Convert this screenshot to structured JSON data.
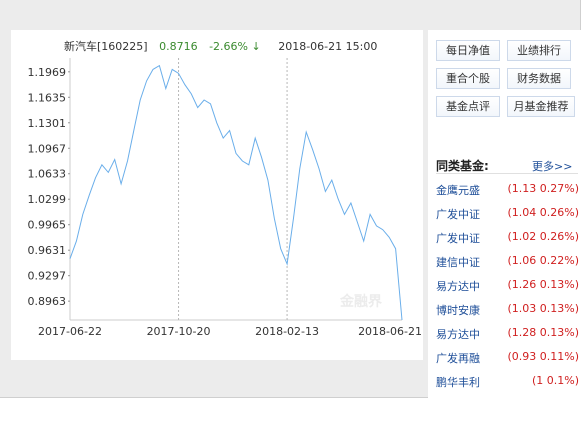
{
  "fund": {
    "name": "新汽车[160225]",
    "price": "0.8716",
    "change": "-2.66% ↓",
    "datetime": "2018-06-21 15:00"
  },
  "buttons": [
    {
      "label": "每日净值"
    },
    {
      "label": "业绩排行"
    },
    {
      "label": "重合个股"
    },
    {
      "label": "财务数据"
    },
    {
      "label": "基金点评"
    },
    {
      "label": "月基金推荐"
    }
  ],
  "peers": {
    "title": "同类基金:",
    "more": "更多>>",
    "items": [
      {
        "name": "金鹰元盛",
        "value": "(1.13 0.27%)"
      },
      {
        "name": "广发中证",
        "value": "(1.04 0.26%)"
      },
      {
        "name": "广发中证",
        "value": "(1.02 0.26%)"
      },
      {
        "name": "建信中证",
        "value": "(1.06 0.22%)"
      },
      {
        "name": "易方达中",
        "value": "(1.26 0.13%)"
      },
      {
        "name": "博时安康",
        "value": "(1.03 0.13%)"
      },
      {
        "name": "易方达中",
        "value": "(1.28 0.13%)"
      },
      {
        "name": "广发再融",
        "value": "(0.93 0.11%)"
      },
      {
        "name": "鹏华丰利",
        "value": "(1 0.1%)"
      }
    ]
  },
  "colors": {
    "line": "#6aaeea",
    "grid": "#b8b8b8",
    "up": "#d02020",
    "down": "#3a8a2e",
    "link": "#1f4f99"
  },
  "chart_data": {
    "type": "line",
    "ylim": [
      0.8716,
      1.215
    ],
    "yticks": [
      1.1969,
      1.1635,
      1.1301,
      1.0967,
      1.0633,
      1.0299,
      0.9965,
      0.9631,
      0.9297,
      0.8963
    ],
    "xticks": [
      "2017-06-22",
      "2017-10-20",
      "2018-02-13",
      "2018-06-21"
    ],
    "x": [
      "2017-06-22",
      "2017-06-29",
      "2017-07-06",
      "2017-07-13",
      "2017-07-20",
      "2017-07-27",
      "2017-08-03",
      "2017-08-10",
      "2017-08-17",
      "2017-08-24",
      "2017-08-31",
      "2017-09-07",
      "2017-09-14",
      "2017-09-21",
      "2017-09-28",
      "2017-10-06",
      "2017-10-13",
      "2017-10-20",
      "2017-10-27",
      "2017-11-03",
      "2017-11-10",
      "2017-11-17",
      "2017-11-24",
      "2017-12-01",
      "2017-12-08",
      "2017-12-15",
      "2017-12-22",
      "2017-12-29",
      "2018-01-05",
      "2018-01-12",
      "2018-01-19",
      "2018-01-26",
      "2018-02-02",
      "2018-02-09",
      "2018-02-13",
      "2018-02-23",
      "2018-03-02",
      "2018-03-09",
      "2018-03-16",
      "2018-03-23",
      "2018-03-30",
      "2018-04-06",
      "2018-04-13",
      "2018-04-20",
      "2018-04-27",
      "2018-05-04",
      "2018-05-11",
      "2018-05-18",
      "2018-05-25",
      "2018-06-01",
      "2018-06-08",
      "2018-06-15",
      "2018-06-21"
    ],
    "values": [
      0.952,
      0.975,
      1.01,
      1.035,
      1.058,
      1.075,
      1.065,
      1.082,
      1.05,
      1.08,
      1.12,
      1.16,
      1.185,
      1.2,
      1.205,
      1.175,
      1.2,
      1.195,
      1.18,
      1.168,
      1.15,
      1.16,
      1.155,
      1.13,
      1.11,
      1.12,
      1.09,
      1.08,
      1.075,
      1.11,
      1.085,
      1.055,
      1.005,
      0.965,
      0.945,
      1.005,
      1.07,
      1.118,
      1.095,
      1.07,
      1.04,
      1.055,
      1.03,
      1.01,
      1.025,
      1.0,
      0.975,
      1.01,
      0.995,
      0.99,
      0.98,
      0.965,
      0.8716
    ]
  }
}
